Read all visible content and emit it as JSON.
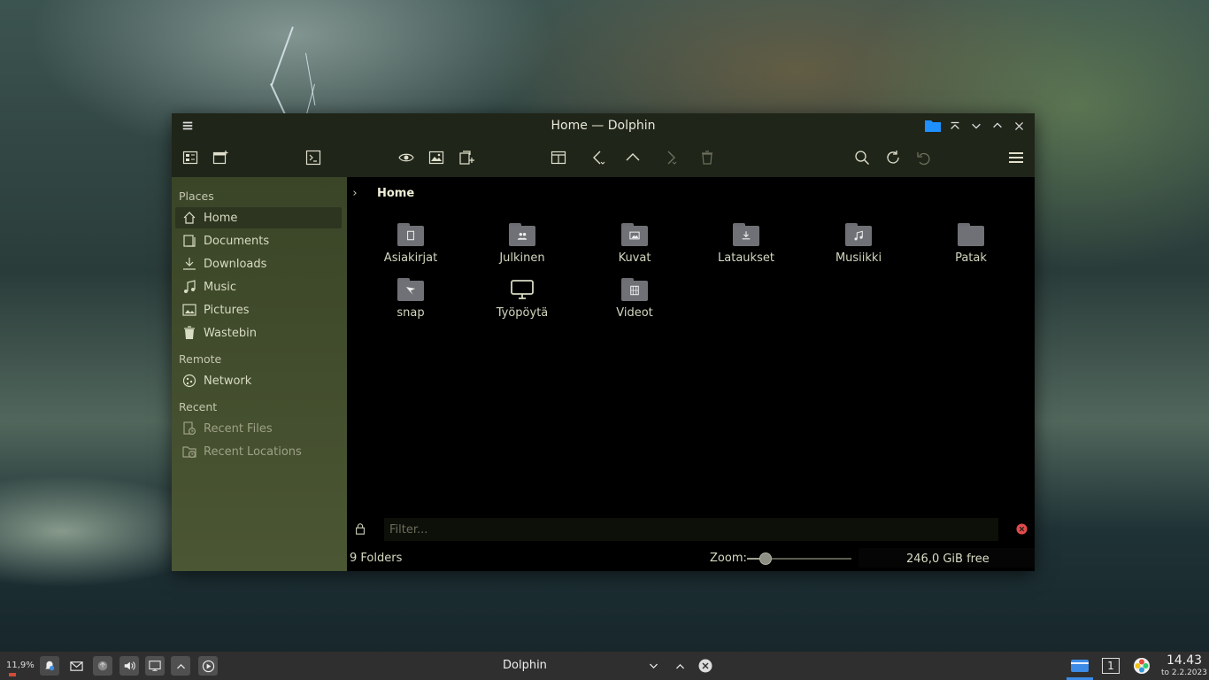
{
  "window": {
    "title": "Home — Dolphin"
  },
  "breadcrumb": {
    "current": "Home"
  },
  "sidebar": {
    "places_header": "Places",
    "places": [
      {
        "label": "Home",
        "icon": "home-icon"
      },
      {
        "label": "Documents",
        "icon": "documents-icon"
      },
      {
        "label": "Downloads",
        "icon": "download-icon"
      },
      {
        "label": "Music",
        "icon": "music-icon"
      },
      {
        "label": "Pictures",
        "icon": "image-icon"
      },
      {
        "label": "Wastebin",
        "icon": "trash-icon"
      }
    ],
    "remote_header": "Remote",
    "remote": [
      {
        "label": "Network",
        "icon": "network-icon"
      }
    ],
    "recent_header": "Recent",
    "recent": [
      {
        "label": "Recent Files",
        "icon": "recent-files-icon"
      },
      {
        "label": "Recent Locations",
        "icon": "recent-locations-icon"
      }
    ]
  },
  "folders": [
    {
      "label": "Asiakirjat",
      "emblem": "document"
    },
    {
      "label": "Julkinen",
      "emblem": "people"
    },
    {
      "label": "Kuvat",
      "emblem": "image"
    },
    {
      "label": "Lataukset",
      "emblem": "download"
    },
    {
      "label": "Musiikki",
      "emblem": "music"
    },
    {
      "label": "Patak",
      "emblem": ""
    },
    {
      "label": "snap",
      "emblem": "snap"
    },
    {
      "label": "Työpöytä",
      "emblem": "desktop"
    },
    {
      "label": "Videot",
      "emblem": "video"
    }
  ],
  "filter": {
    "placeholder": "Filter..."
  },
  "status": {
    "count": "9 Folders",
    "zoom_label": "Zoom:",
    "zoom_level": 0.18,
    "free_space": "246,0 GiB free"
  },
  "taskbar": {
    "cpu": "11,9%",
    "task_label": "Dolphin",
    "desktop_number": "1",
    "time": "14.43",
    "date": "to 2.2.2023"
  },
  "colors": {
    "accent_folder_blue": "#1e90ff",
    "sidebar_bg": "#435031",
    "titlebar_bg": "#1f2519"
  }
}
